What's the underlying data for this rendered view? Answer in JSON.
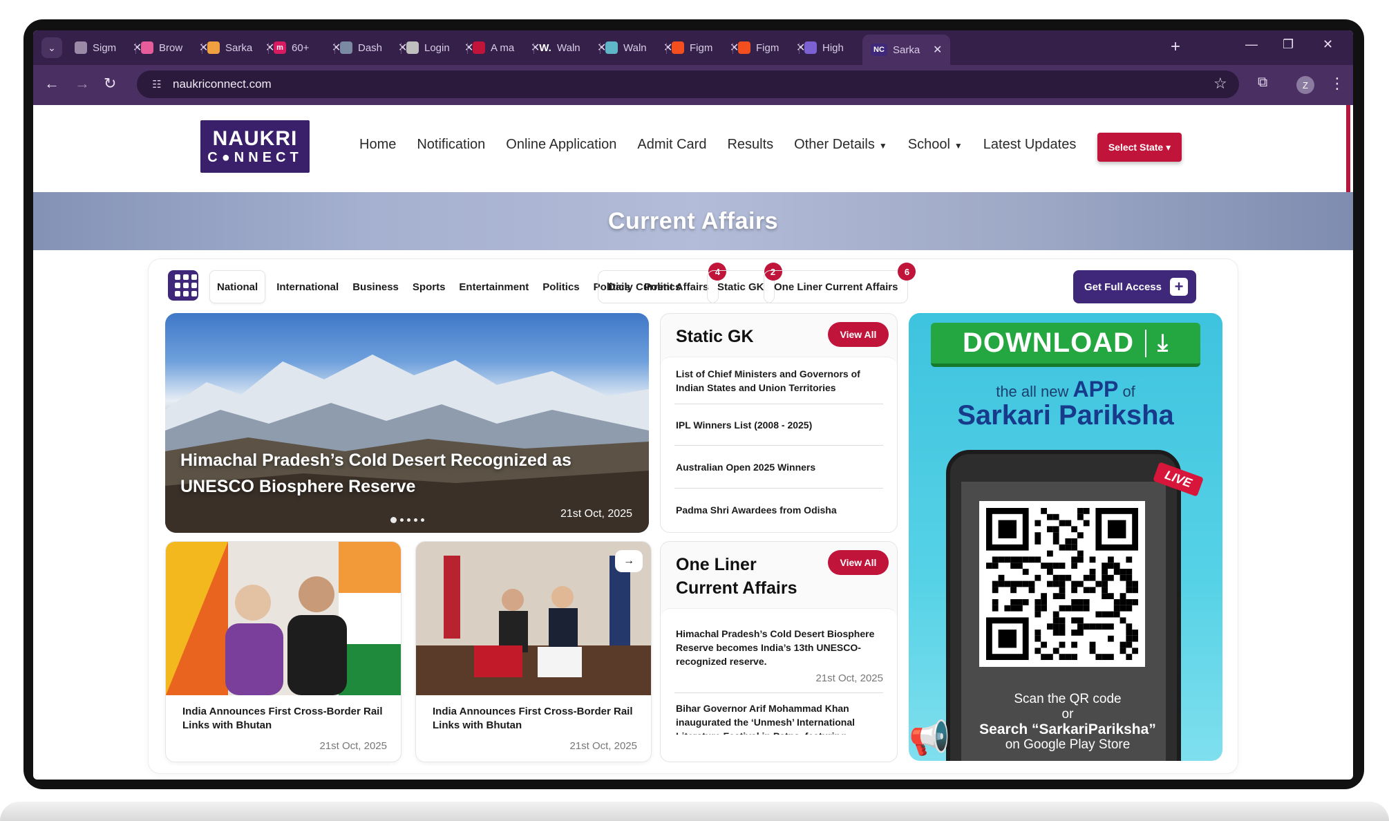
{
  "browser": {
    "tabs": [
      {
        "title": "Sigm",
        "fav": "globe-icon",
        "color": "#9a8aa8"
      },
      {
        "title": "Brow",
        "fav": "dribbble-icon",
        "color": "#e75c9a"
      },
      {
        "title": "Sarka",
        "fav": "sarkari-icon",
        "color": "#f0a040"
      },
      {
        "title": "60+",
        "fav": "m-icon",
        "color": "#d81b60"
      },
      {
        "title": "Dash",
        "fav": "wordpress-icon",
        "color": "#7a8aa3"
      },
      {
        "title": "Login",
        "fav": "hat-icon",
        "color": "#bfbfbf"
      },
      {
        "title": "A ma",
        "fav": "dot-icon",
        "color": "#c0143b"
      },
      {
        "title": "Waln",
        "fav": "w-icon",
        "color": "#35204a"
      },
      {
        "title": "Waln",
        "fav": "bot-icon",
        "color": "#5eb6c8"
      },
      {
        "title": "Figm",
        "fav": "figma-icon",
        "color": "#f24e1e"
      },
      {
        "title": "Figm",
        "fav": "figma-icon",
        "color": "#f24e1e"
      },
      {
        "title": "High",
        "fav": "list-icon",
        "color": "#7b61d1"
      },
      {
        "title": "Sarka",
        "fav": "nc-icon",
        "color": "#3f2779"
      }
    ],
    "fav_letters": {
      "w": "W.",
      "nc": "NC",
      "m": "m"
    },
    "url": "naukriconnect.com",
    "profile_initial": "Z"
  },
  "site": {
    "logo_line1": "NAUKRI",
    "logo_line2": "C●NNECT",
    "nav": [
      {
        "label": "Home"
      },
      {
        "label": "Notification"
      },
      {
        "label": "Online Application"
      },
      {
        "label": "Admit Card"
      },
      {
        "label": "Results"
      },
      {
        "label": "Other Details",
        "dropdown": true
      },
      {
        "label": "School",
        "dropdown": true
      },
      {
        "label": "Latest Updates"
      }
    ],
    "select_state": "Select State ▾",
    "banner_title": "Current Affairs"
  },
  "filters": {
    "categories": [
      "National",
      "International",
      "Business",
      "Sports",
      "Entertainment",
      "Politics",
      "Politics",
      "Politics"
    ],
    "pills": [
      {
        "label": "Daily Current Affairs",
        "badge": "4"
      },
      {
        "label": "Static GK",
        "badge": "2"
      },
      {
        "label": "One Liner Current Affairs",
        "badge": "6"
      }
    ],
    "full_access": "Get Full Access",
    "plus": "+"
  },
  "hero": {
    "headline": "Himachal Pradesh’s Cold Desert Recognized as UNESCO Biosphere Reserve",
    "date": "21st Oct, 2025"
  },
  "news_cards": [
    {
      "title": "India Announces First Cross-Border Rail Links with Bhutan",
      "date": "21st Oct, 2025"
    },
    {
      "title": "India Announces First Cross-Border Rail Links with Bhutan",
      "date": "21st Oct, 2025",
      "arrow": "→"
    }
  ],
  "static_gk": {
    "title": "Static GK",
    "view_all": "View All",
    "items": [
      "List of Chief Ministers and Governors of Indian States and Union Territories",
      "IPL Winners List (2008 - 2025)",
      "Australian Open 2025 Winners",
      "Padma Shri Awardees from Odisha"
    ]
  },
  "one_liner": {
    "title_line1": "One Liner",
    "title_line2": "Current Affairs",
    "view_all": "View All",
    "items": [
      {
        "text": "Himachal Pradesh’s Cold Desert Biosphere Reserve becomes India’s 13th UNESCO-recognized reserve.",
        "date": "21st Oct, 2025"
      },
      {
        "text": "Bihar Governor Arif Mohammad Khan inaugurated the ‘Unmesh’ International Literature Festival in Patna, featuring"
      }
    ]
  },
  "promo": {
    "download": "DOWNLOAD",
    "sub_pre": "the all new",
    "sub_app": "APP",
    "sub_post": "of",
    "brand": "Sarkari Pariksha",
    "live": "LIVE",
    "scan1": "Scan the QR code",
    "scan2": "or",
    "scan3": "Search “SarkariPariksha”",
    "scan4": "on Google Play Store"
  }
}
